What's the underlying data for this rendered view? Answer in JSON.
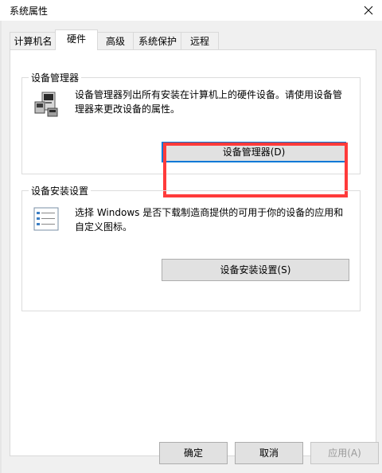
{
  "window": {
    "title": "系统属性"
  },
  "tabs": [
    {
      "label": "计算机名",
      "active": false
    },
    {
      "label": "硬件",
      "active": true
    },
    {
      "label": "高级",
      "active": false
    },
    {
      "label": "系统保护",
      "active": false
    },
    {
      "label": "远程",
      "active": false
    }
  ],
  "device_manager": {
    "title": "设备管理器",
    "description_line1": "设备管理器列出所有安装在计算机上的硬件设备。请使用设备管",
    "description_line2": "理器来更改设备的属性。",
    "button_label": "设备管理器(D)"
  },
  "device_install": {
    "title": "设备安装设置",
    "description_line1": "选择 Windows 是否下载制造商提供的可用于你的设备的应用和",
    "description_line2": "自定义图标。",
    "button_label": "设备安装设置(S)"
  },
  "footer": {
    "ok_label": "确定",
    "cancel_label": "取消",
    "apply_label": "应用(A)",
    "apply_enabled": false
  },
  "colors": {
    "highlight": "#ff3b3b",
    "focus": "#0078d7"
  }
}
